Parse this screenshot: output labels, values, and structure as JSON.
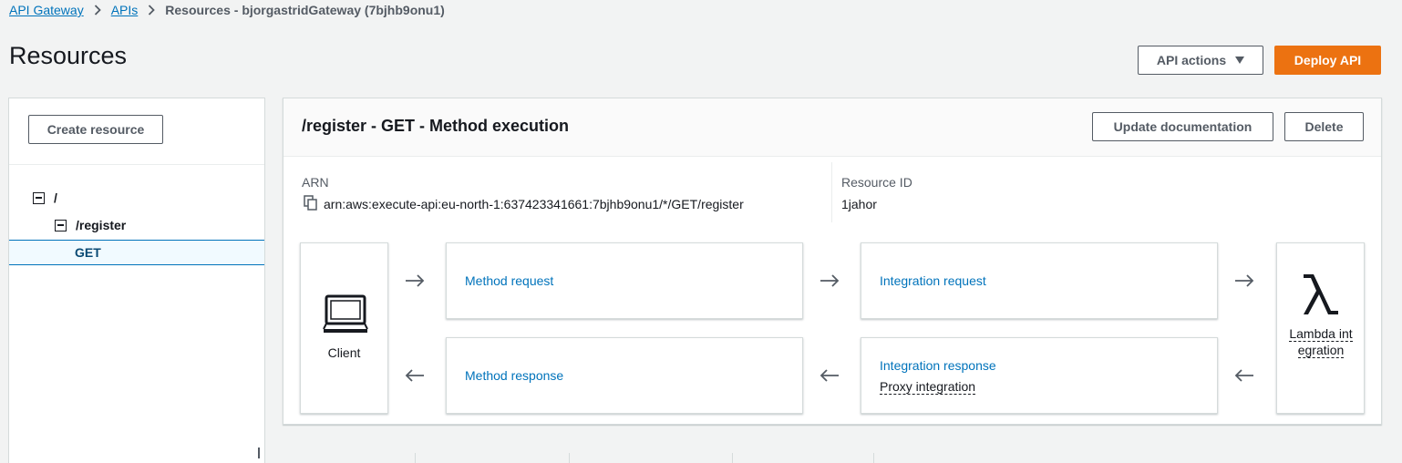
{
  "breadcrumb": {
    "items": [
      "API Gateway",
      "APIs"
    ],
    "current": "Resources - bjorgastridGateway (7bjhb9onu1)"
  },
  "page": {
    "title": "Resources",
    "api_actions_label": "API actions",
    "deploy_label": "Deploy API"
  },
  "sidebar": {
    "create_resource_label": "Create resource",
    "tree": [
      {
        "label": "/",
        "expanded": true
      },
      {
        "label": "/register",
        "expanded": true
      },
      {
        "label": "GET",
        "selected": true
      }
    ]
  },
  "method": {
    "title": "/register - GET - Method execution",
    "update_doc_label": "Update documentation",
    "delete_label": "Delete",
    "arn_label": "ARN",
    "arn_value": "arn:aws:execute-api:eu-north-1:637423341661:7bjhb9onu1/*/GET/register",
    "resource_id_label": "Resource ID",
    "resource_id_value": "1jahor"
  },
  "flow": {
    "client_label": "Client",
    "method_request": "Method request",
    "method_response": "Method response",
    "integration_request": "Integration request",
    "integration_response": "Integration response",
    "proxy_label": "Proxy integration",
    "lambda_label": "Lambda integration"
  },
  "colors": {
    "link": "#0073bb",
    "primary": "#ec7211",
    "selected_bg": "#f1faff"
  }
}
